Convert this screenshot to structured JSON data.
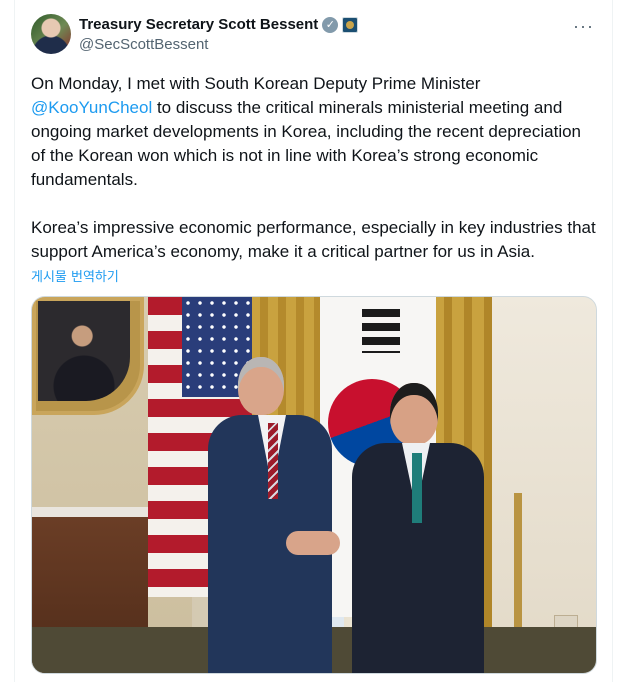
{
  "post": {
    "author": {
      "display_name": "Treasury Secretary Scott Bessent",
      "handle": "@SecScottBessent",
      "verified_icon": "verified-badge-icon",
      "affiliate_icon": "treasury-seal-icon"
    },
    "more_label": "···",
    "text_before_mention": "On Monday, I met with South Korean Deputy Prime Minister ",
    "mention": "@KooYunCheol",
    "text_after_mention": " to discuss the critical minerals ministerial meeting and ongoing market developments in Korea, including the recent depreciation of the Korean won which is not in line with Korea’s strong economic fundamentals.\n\nKorea’s impressive economic performance, especially in key industries that support America’s economy, make it a critical partner for us in Asia.",
    "translate_label": "게시물 번역하기",
    "colors": {
      "link": "#1d9bf0",
      "secondary": "#536471"
    }
  }
}
